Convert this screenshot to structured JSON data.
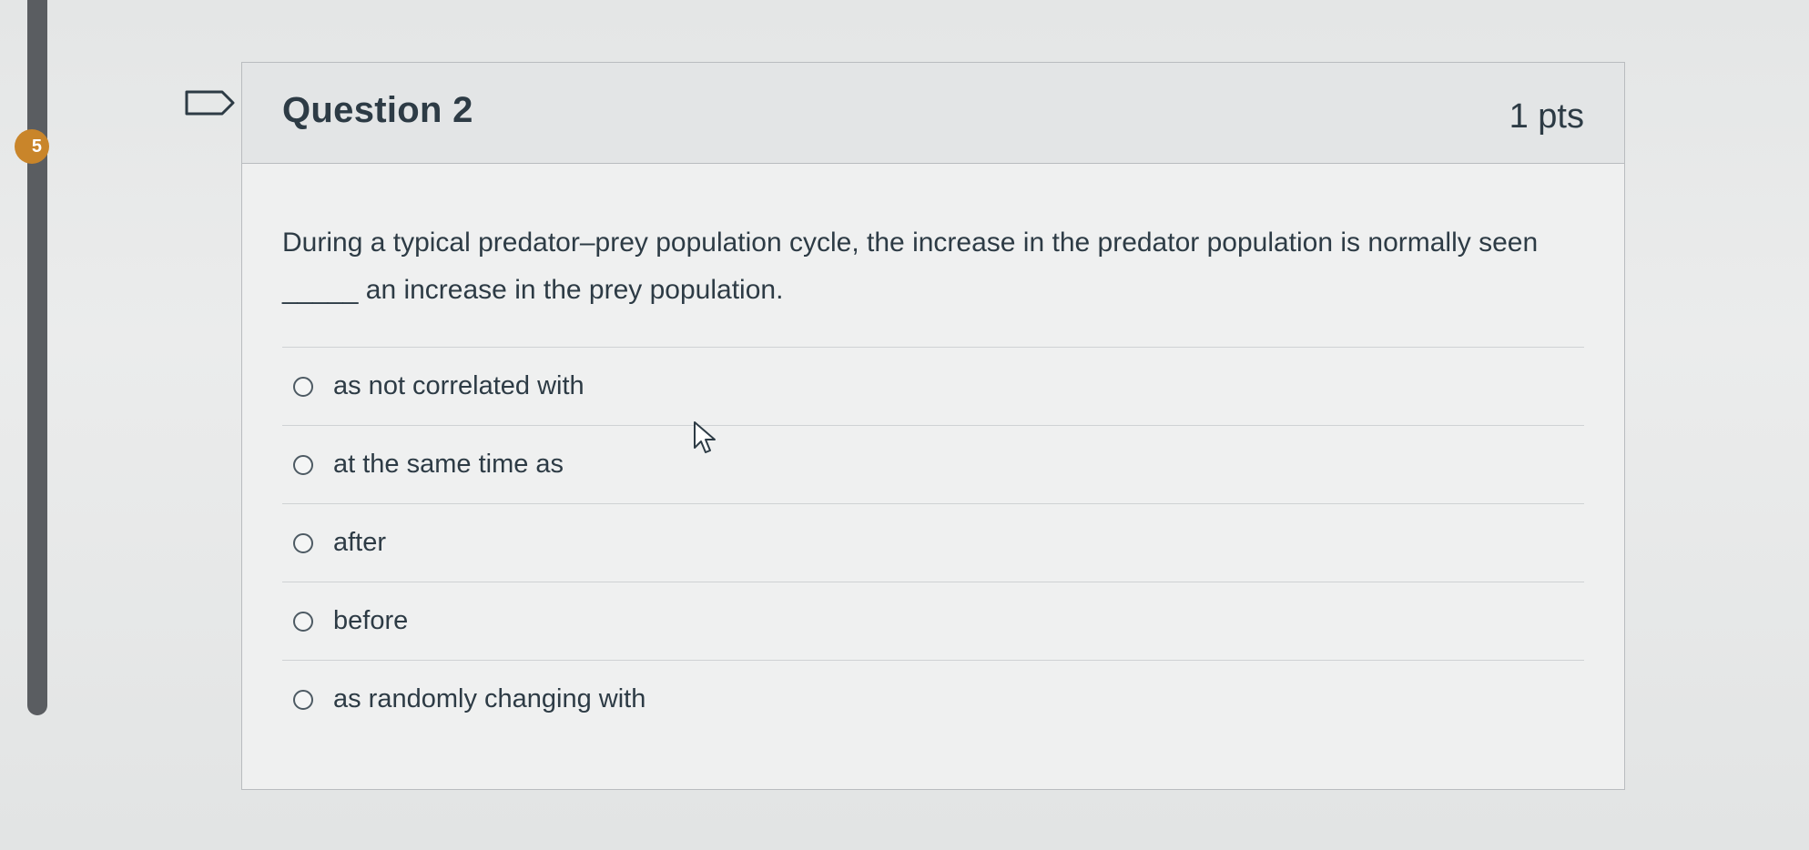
{
  "rail": {
    "badge": "5",
    "badge_color": "#c9852a"
  },
  "question": {
    "title": "Question 2",
    "points": "1 pts",
    "text": "During a typical predator–prey population cycle, the increase in the predator population is normally seen _____ an increase in the prey population."
  },
  "answers": [
    {
      "label": "as not correlated with"
    },
    {
      "label": "at the same time as"
    },
    {
      "label": "after"
    },
    {
      "label": "before"
    },
    {
      "label": "as randomly changing with"
    }
  ],
  "icons": {
    "flag": "flag-outline-icon",
    "cursor": "mouse-pointer-icon"
  },
  "colors": {
    "text": "#2d3b45",
    "border": "#b9bcbf",
    "header_bg": "#e3e5e6"
  }
}
